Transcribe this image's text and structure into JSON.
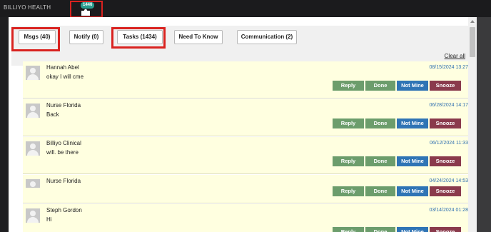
{
  "app": {
    "brand": "BILLIYO HEALTH",
    "notification_count": "1446"
  },
  "tabs": [
    {
      "label": "Msgs (40)"
    },
    {
      "label": "Notify (0)"
    },
    {
      "label": "Tasks (1434)"
    },
    {
      "label": "Need To Know"
    },
    {
      "label": "Communication (2)"
    }
  ],
  "actions": {
    "clear_all": "Clear all"
  },
  "buttons": {
    "reply": "Reply",
    "done": "Done",
    "not_mine": "Not Mine",
    "snooze": "Snooze"
  },
  "messages": [
    {
      "sender": "Hannah Abel",
      "text": "okay I will cme",
      "time": "08/15/2024 13:27"
    },
    {
      "sender": "Nurse Florida",
      "text": "Back",
      "time": "06/28/2024 14:17"
    },
    {
      "sender": "Billiyo Clinical",
      "text": "will. be there",
      "time": "06/12/2024 11:33"
    },
    {
      "sender": "Nurse Florida",
      "text": "",
      "time": "04/24/2024 14:53"
    },
    {
      "sender": "Steph Gordon",
      "text": "Hi",
      "time": "03/14/2024 01:28"
    }
  ],
  "colors": {
    "highlight": "#d9221f",
    "message_bg": "#ffffe0",
    "reply_done": "#6c9d6c",
    "not_mine": "#2f74b5",
    "snooze": "#8a3a4c",
    "time_text": "#2f6fb0"
  }
}
